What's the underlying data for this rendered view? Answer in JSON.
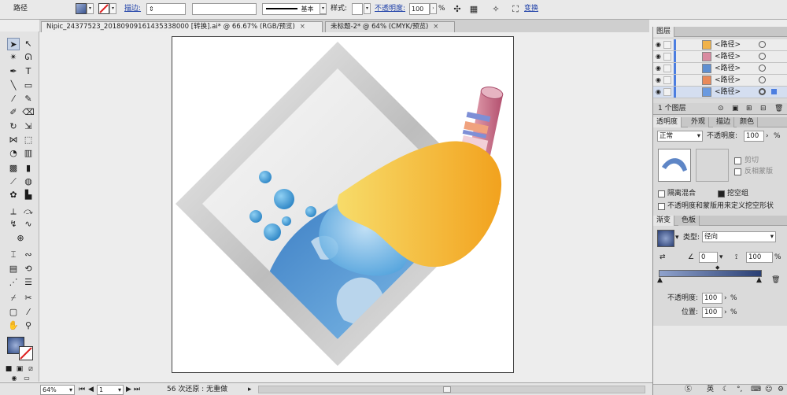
{
  "control_bar": {
    "object_label": "路径",
    "stroke_label": "描边:",
    "stroke_line_label": "基本",
    "style_label": "样式:",
    "opacity_label": "不透明度:",
    "opacity_value": "100",
    "opacity_unit": "%",
    "transform_label": "变换"
  },
  "tabs": [
    {
      "label": "Nipic_24377523_20180909161435338000 [转换].ai* @ 66.67% (RGB/预览)",
      "close": "×"
    },
    {
      "label": "未标题-2* @ 64% (CMYK/预览)",
      "close": "×"
    }
  ],
  "layers_panel": {
    "title": "图层",
    "items": [
      {
        "name": "<路径>",
        "thumb_color": "#f0b24a"
      },
      {
        "name": "<路径>",
        "thumb_color": "#d98aa0"
      },
      {
        "name": "<路径>",
        "thumb_color": "#5f8fd1"
      },
      {
        "name": "<路径>",
        "thumb_color": "#e98a5a"
      },
      {
        "name": "<路径>",
        "thumb_color": "#6a9ae0"
      }
    ],
    "footer_text": "1 个图层"
  },
  "transparency_panel": {
    "tabs": [
      "透明度",
      "外观",
      "描边",
      "颜色"
    ],
    "blend_mode": "正常",
    "opacity_label": "不透明度:",
    "opacity_value": "100",
    "opacity_unit": "%",
    "clip_label": "剪切",
    "invert_mask_label": "反相蒙版",
    "isolate_blending_label": "隔离混合",
    "knockout_group_label": "挖空组",
    "opacity_mask_label": "不透明度和蒙版用来定义挖空形状"
  },
  "gradient_panel": {
    "tabs": [
      "渐变",
      "色板"
    ],
    "type_label": "类型:",
    "type_value": "径向",
    "angle_value": "0",
    "aspect_value": "100",
    "unit": "%",
    "opacity_label": "不透明度:",
    "opacity_value": "100",
    "location_label": "位置:",
    "location_value": "100"
  },
  "status_bar": {
    "zoom": "64%",
    "page": "1",
    "undo_text": "56 次还原 : 无重做"
  },
  "tray": {
    "ime": "英"
  },
  "colors": {
    "gradient_start": "#8fa2cc",
    "gradient_end": "#2a3f74",
    "selection_blue": "#4c7ee0"
  }
}
